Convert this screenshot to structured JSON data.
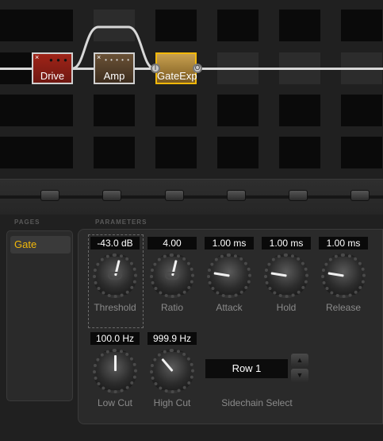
{
  "signal_chain": {
    "blocks": [
      {
        "label": "Drive",
        "icon": "drive-pedal-icon"
      },
      {
        "label": "Amp",
        "icon": "amp-head-icon"
      },
      {
        "label": "GateExp",
        "icon": "gate-expander-icon"
      }
    ],
    "ports": {
      "input": "I",
      "output": "O"
    }
  },
  "editor": {
    "pages_header": "PAGES",
    "parameters_header": "PARAMETERS",
    "pages": [
      "Gate"
    ],
    "params": [
      {
        "label": "Threshold",
        "value": "-43.0 dB",
        "level": 0.55
      },
      {
        "label": "Ratio",
        "value": "4.00",
        "level": 0.55
      },
      {
        "label": "Attack",
        "value": "1.00 ms",
        "level": 0.2
      },
      {
        "label": "Hold",
        "value": "1.00 ms",
        "level": 0.2
      },
      {
        "label": "Release",
        "value": "1.00 ms",
        "level": 0.2
      },
      {
        "label": "Low Cut",
        "value": "100.0 Hz",
        "level": 0.5
      },
      {
        "label": "High Cut",
        "value": "999.9 Hz",
        "level": 0.35
      }
    ],
    "sidechain": {
      "label": "Sidechain Select",
      "value": "Row 1"
    }
  },
  "colors": {
    "accent": "#f2b80a",
    "drive": "#a02418",
    "background": "#1b1b1b"
  }
}
